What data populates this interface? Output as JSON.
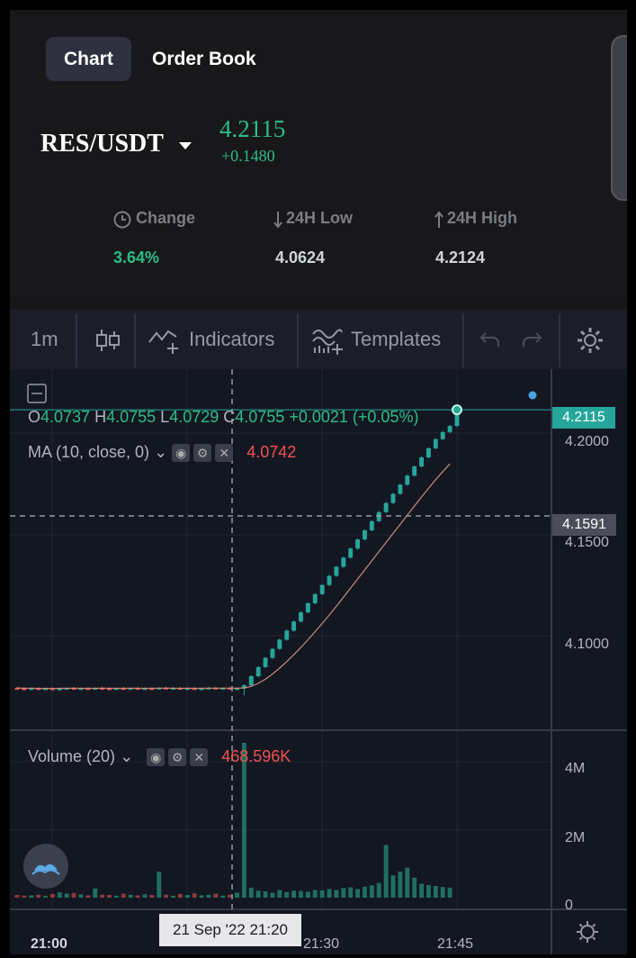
{
  "tabs": {
    "chart": "Chart",
    "order_book": "Order Book"
  },
  "ticker": {
    "pair": "RES/USDT",
    "price": "4.2115",
    "change": "+0.1480"
  },
  "stats": {
    "change_label": "Change",
    "change_value": "3.64%",
    "low_label": "24H Low",
    "low_value": "4.0624",
    "high_label": "24H High",
    "high_value": "4.2124"
  },
  "toolbar": {
    "interval": "1m",
    "indicators": "Indicators",
    "templates": "Templates"
  },
  "legend": {
    "o_key": "O",
    "o_val": "4.0737",
    "h_key": "H",
    "h_val": "4.0755",
    "l_key": "L",
    "l_val": "4.0729",
    "c_key": "C",
    "c_val": "4.0755",
    "chg": "+0.0021 (+0.05%)",
    "ma_label": "MA (10, close, 0)",
    "ma_value": "4.0742",
    "volume_label": "Volume (20)",
    "volume_value": "468.596K"
  },
  "price_axis": {
    "current": "4.2115",
    "crosshair": "4.1591",
    "ticks": [
      "4.2000",
      "4.1500",
      "4.1000"
    ]
  },
  "volume_axis": {
    "ticks": [
      "4M",
      "2M",
      "0"
    ]
  },
  "time_axis": {
    "ticks": [
      "21:00",
      "21:30",
      "21:45"
    ],
    "crosshair": "21 Sep '22   21:20"
  },
  "colors": {
    "up": "#26a69a",
    "down": "#ef5350",
    "accent": "#2ebd85",
    "ma": "#c98a7a",
    "dot": "#4aa3df"
  },
  "chart_data": {
    "type": "candlestick",
    "pair": "RES/USDT",
    "interval": "1m",
    "price_ylim": [
      4.06,
      4.215
    ],
    "candles": [
      {
        "o": 4.0742,
        "h": 4.0748,
        "l": 4.0735,
        "c": 4.074
      },
      {
        "o": 4.074,
        "h": 4.0746,
        "l": 4.0734,
        "c": 4.0738
      },
      {
        "o": 4.0738,
        "h": 4.0744,
        "l": 4.0733,
        "c": 4.0741
      },
      {
        "o": 4.0741,
        "h": 4.0746,
        "l": 4.0735,
        "c": 4.0737
      },
      {
        "o": 4.0737,
        "h": 4.0743,
        "l": 4.0732,
        "c": 4.074
      },
      {
        "o": 4.074,
        "h": 4.0745,
        "l": 4.0734,
        "c": 4.0736
      },
      {
        "o": 4.0736,
        "h": 4.0742,
        "l": 4.0731,
        "c": 4.0739
      },
      {
        "o": 4.0739,
        "h": 4.0745,
        "l": 4.0734,
        "c": 4.0742
      },
      {
        "o": 4.0742,
        "h": 4.0747,
        "l": 4.0736,
        "c": 4.0738
      },
      {
        "o": 4.0738,
        "h": 4.0744,
        "l": 4.0733,
        "c": 4.0741
      },
      {
        "o": 4.0741,
        "h": 4.0746,
        "l": 4.0736,
        "c": 4.0739
      },
      {
        "o": 4.0739,
        "h": 4.0745,
        "l": 4.0733,
        "c": 4.0742
      },
      {
        "o": 4.0742,
        "h": 4.0748,
        "l": 4.0737,
        "c": 4.074
      },
      {
        "o": 4.074,
        "h": 4.0745,
        "l": 4.0734,
        "c": 4.0737
      },
      {
        "o": 4.0737,
        "h": 4.0743,
        "l": 4.0732,
        "c": 4.0741
      },
      {
        "o": 4.0741,
        "h": 4.0747,
        "l": 4.0736,
        "c": 4.0739
      },
      {
        "o": 4.0739,
        "h": 4.0744,
        "l": 4.0733,
        "c": 4.0742
      },
      {
        "o": 4.0742,
        "h": 4.0748,
        "l": 4.0737,
        "c": 4.0738
      },
      {
        "o": 4.0738,
        "h": 4.0744,
        "l": 4.0733,
        "c": 4.0741
      },
      {
        "o": 4.0741,
        "h": 4.0746,
        "l": 4.0735,
        "c": 4.0739
      },
      {
        "o": 4.0739,
        "h": 4.0745,
        "l": 4.0734,
        "c": 4.0743
      },
      {
        "o": 4.0743,
        "h": 4.0748,
        "l": 4.0737,
        "c": 4.074
      },
      {
        "o": 4.074,
        "h": 4.0746,
        "l": 4.0735,
        "c": 4.0742
      },
      {
        "o": 4.0742,
        "h": 4.0747,
        "l": 4.0736,
        "c": 4.0739
      },
      {
        "o": 4.0739,
        "h": 4.0745,
        "l": 4.0734,
        "c": 4.0741
      },
      {
        "o": 4.0741,
        "h": 4.0746,
        "l": 4.0735,
        "c": 4.0738
      },
      {
        "o": 4.0738,
        "h": 4.0744,
        "l": 4.0733,
        "c": 4.074
      },
      {
        "o": 4.074,
        "h": 4.0746,
        "l": 4.0735,
        "c": 4.0743
      },
      {
        "o": 4.0743,
        "h": 4.0748,
        "l": 4.0737,
        "c": 4.074
      },
      {
        "o": 4.074,
        "h": 4.0745,
        "l": 4.0734,
        "c": 4.0742
      },
      {
        "o": 4.0742,
        "h": 4.0748,
        "l": 4.0736,
        "c": 4.0739
      },
      {
        "o": 4.0739,
        "h": 4.0745,
        "l": 4.0734,
        "c": 4.0741
      },
      {
        "o": 4.0738,
        "h": 4.076,
        "l": 4.0705,
        "c": 4.0755
      },
      {
        "o": 4.0755,
        "h": 4.0805,
        "l": 4.075,
        "c": 4.08
      },
      {
        "o": 4.08,
        "h": 4.085,
        "l": 4.0795,
        "c": 4.0845
      },
      {
        "o": 4.0845,
        "h": 4.0895,
        "l": 4.084,
        "c": 4.089
      },
      {
        "o": 4.089,
        "h": 4.094,
        "l": 4.0885,
        "c": 4.0935
      },
      {
        "o": 4.0935,
        "h": 4.0985,
        "l": 4.093,
        "c": 4.098
      },
      {
        "o": 4.098,
        "h": 4.103,
        "l": 4.0975,
        "c": 4.1025
      },
      {
        "o": 4.1025,
        "h": 4.1075,
        "l": 4.102,
        "c": 4.107
      },
      {
        "o": 4.107,
        "h": 4.112,
        "l": 4.1065,
        "c": 4.1115
      },
      {
        "o": 4.1115,
        "h": 4.1165,
        "l": 4.111,
        "c": 4.116
      },
      {
        "o": 4.116,
        "h": 4.121,
        "l": 4.1155,
        "c": 4.1205
      },
      {
        "o": 4.1205,
        "h": 4.1255,
        "l": 4.12,
        "c": 4.125
      },
      {
        "o": 4.125,
        "h": 4.13,
        "l": 4.1245,
        "c": 4.1295
      },
      {
        "o": 4.1295,
        "h": 4.1345,
        "l": 4.129,
        "c": 4.134
      },
      {
        "o": 4.134,
        "h": 4.139,
        "l": 4.1335,
        "c": 4.1385
      },
      {
        "o": 4.1385,
        "h": 4.1435,
        "l": 4.138,
        "c": 4.143
      },
      {
        "o": 4.143,
        "h": 4.148,
        "l": 4.1425,
        "c": 4.1475
      },
      {
        "o": 4.1475,
        "h": 4.1525,
        "l": 4.147,
        "c": 4.152
      },
      {
        "o": 4.152,
        "h": 4.157,
        "l": 4.1515,
        "c": 4.1565
      },
      {
        "o": 4.1565,
        "h": 4.1615,
        "l": 4.156,
        "c": 4.161
      },
      {
        "o": 4.161,
        "h": 4.166,
        "l": 4.1605,
        "c": 4.1655
      },
      {
        "o": 4.1655,
        "h": 4.1705,
        "l": 4.165,
        "c": 4.17
      },
      {
        "o": 4.17,
        "h": 4.175,
        "l": 4.1695,
        "c": 4.1745
      },
      {
        "o": 4.1745,
        "h": 4.1795,
        "l": 4.174,
        "c": 4.179
      },
      {
        "o": 4.179,
        "h": 4.184,
        "l": 4.1785,
        "c": 4.1835
      },
      {
        "o": 4.1835,
        "h": 4.1885,
        "l": 4.183,
        "c": 4.188
      },
      {
        "o": 4.188,
        "h": 4.193,
        "l": 4.1875,
        "c": 4.1925
      },
      {
        "o": 4.1925,
        "h": 4.1975,
        "l": 4.192,
        "c": 4.197
      },
      {
        "o": 4.197,
        "h": 4.201,
        "l": 4.1965,
        "c": 4.2005
      },
      {
        "o": 4.2005,
        "h": 4.204,
        "l": 4.2,
        "c": 4.2035
      },
      {
        "o": 4.2035,
        "h": 4.2124,
        "l": 4.203,
        "c": 4.2115
      }
    ],
    "ma": [
      4.0742,
      4.074,
      4.0741,
      4.0739,
      4.074,
      4.0739,
      4.074,
      4.074,
      4.0741,
      4.074,
      4.074,
      4.074,
      4.0741,
      4.074,
      4.074,
      4.074,
      4.0741,
      4.074,
      4.074,
      4.074,
      4.0741,
      4.0741,
      4.0741,
      4.074,
      4.0741,
      4.074,
      4.074,
      4.0741,
      4.0741,
      4.0741,
      4.0741,
      4.0741,
      4.0742,
      4.075,
      4.0765,
      4.0785,
      4.081,
      4.084,
      4.0872,
      4.0906,
      4.0942,
      4.098,
      4.102,
      4.106,
      4.1102,
      4.1145,
      4.119,
      4.1235,
      4.128,
      4.1325,
      4.137,
      4.1415,
      4.146,
      4.1505,
      4.155,
      4.1595,
      4.164,
      4.1685,
      4.1728,
      4.177,
      4.181,
      4.1848
    ],
    "volume_ylim": [
      0,
      4800000
    ],
    "volumes": [
      80000,
      60000,
      70000,
      90000,
      50000,
      110000,
      160000,
      120000,
      140000,
      100000,
      70000,
      280000,
      90000,
      80000,
      60000,
      120000,
      90000,
      70000,
      100000,
      80000,
      780000,
      90000,
      60000,
      110000,
      80000,
      130000,
      70000,
      90000,
      120000,
      60000,
      90000,
      150000,
      4650000,
      300000,
      210000,
      190000,
      150000,
      230000,
      170000,
      210000,
      200000,
      180000,
      230000,
      220000,
      260000,
      230000,
      290000,
      310000,
      260000,
      330000,
      370000,
      440000,
      1580000,
      670000,
      780000,
      900000,
      600000,
      420000,
      380000,
      350000,
      320000,
      300000
    ]
  }
}
